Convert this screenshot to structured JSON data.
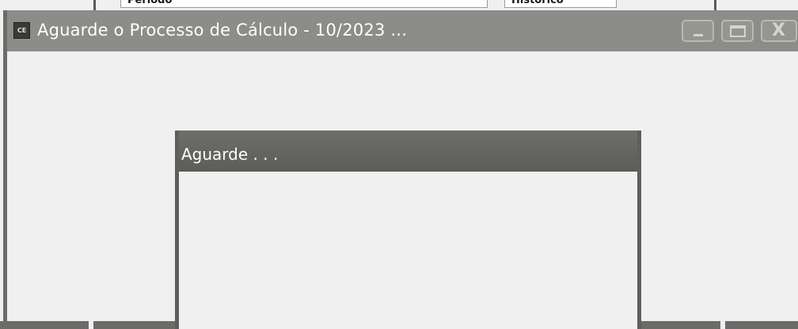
{
  "background": {
    "field_1_label": "Período",
    "field_2_label": "Histórico"
  },
  "window": {
    "app_icon_text": "CE",
    "title": "Aguarde o Processo de Cálculo - 10/2023 ...",
    "controls": {
      "minimize_icon": "minimize-icon",
      "maximize_icon": "maximize-icon",
      "close_glyph": "X"
    }
  },
  "dialog": {
    "title": "Aguarde . . ."
  },
  "colors": {
    "titlebar": "#8c8c88",
    "dialog_titlebar": "#5c5c59",
    "client_area": "#f0f0f0"
  }
}
